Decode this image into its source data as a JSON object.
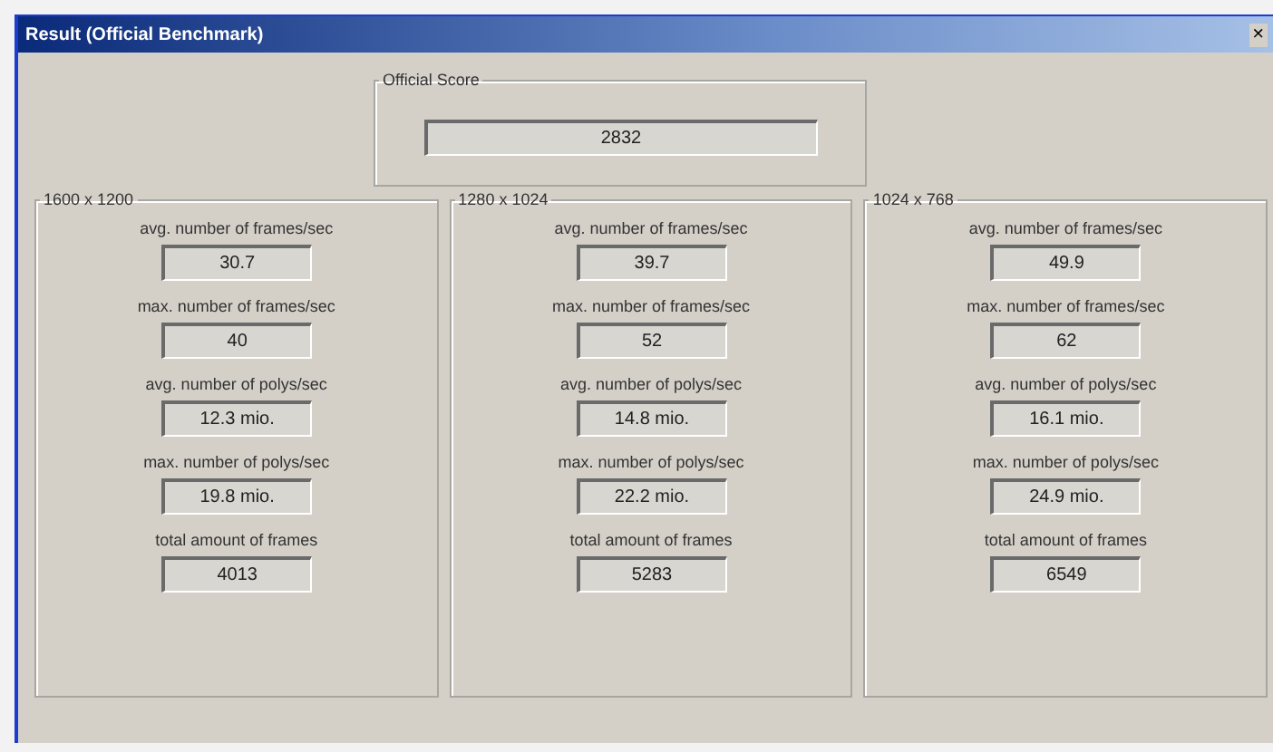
{
  "window": {
    "title": "Result (Official Benchmark)",
    "close": "×"
  },
  "official_score": {
    "label": "Official Score",
    "value": "2832"
  },
  "groups": [
    {
      "title": "1600 x 1200",
      "stats": [
        {
          "label": "avg. number of frames/sec",
          "value": "30.7"
        },
        {
          "label": "max. number of frames/sec",
          "value": "40"
        },
        {
          "label": "avg. number of polys/sec",
          "value": "12.3 mio."
        },
        {
          "label": "max. number of polys/sec",
          "value": "19.8 mio."
        },
        {
          "label": "total amount of frames",
          "value": "4013"
        }
      ]
    },
    {
      "title": "1280 x 1024",
      "stats": [
        {
          "label": "avg. number of frames/sec",
          "value": "39.7"
        },
        {
          "label": "max. number of frames/sec",
          "value": "52"
        },
        {
          "label": "avg. number of polys/sec",
          "value": "14.8 mio."
        },
        {
          "label": "max. number of polys/sec",
          "value": "22.2 mio."
        },
        {
          "label": "total amount of frames",
          "value": "5283"
        }
      ]
    },
    {
      "title": "1024 x 768",
      "stats": [
        {
          "label": "avg. number of frames/sec",
          "value": "49.9"
        },
        {
          "label": "max. number of frames/sec",
          "value": "62"
        },
        {
          "label": "avg. number of polys/sec",
          "value": "16.1 mio."
        },
        {
          "label": "max. number of polys/sec",
          "value": "24.9 mio."
        },
        {
          "label": "total amount of frames",
          "value": "6549"
        }
      ]
    }
  ]
}
